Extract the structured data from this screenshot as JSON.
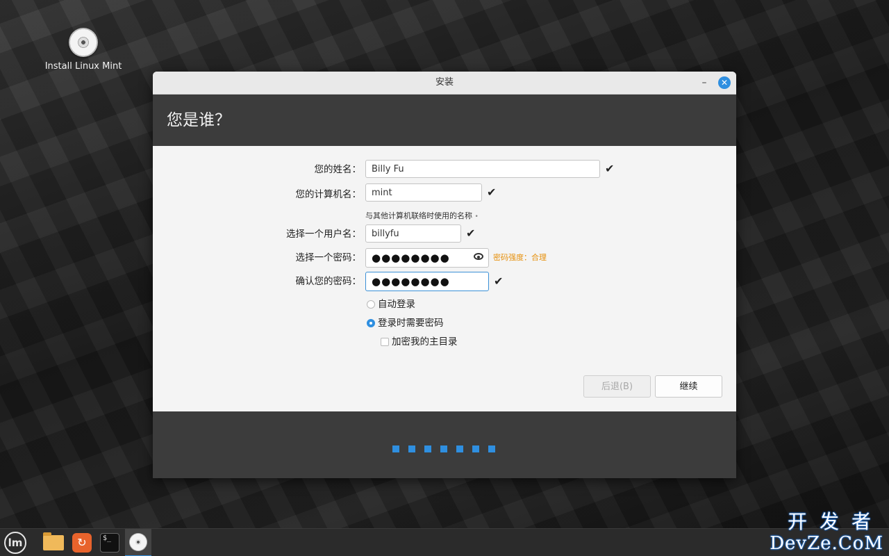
{
  "desktop": {
    "icon_label": "Install Linux Mint"
  },
  "window": {
    "title": "安装",
    "minimize_glyph": "–",
    "close_glyph": "✕",
    "heading": "您是谁？"
  },
  "form": {
    "name_label": "您的姓名：",
    "name_value": "Billy Fu",
    "computer_label": "您的计算机名：",
    "computer_value": "mint",
    "computer_hint": "与其他计算机联络时使用的名称",
    "hint_marker": "•",
    "username_label": "选择一个用户名：",
    "username_value": "billyfu",
    "password_label": "选择一个密码：",
    "password_value": "●●●●●●●●",
    "password_strength": "密码强度：合理",
    "confirm_label": "确认您的密码：",
    "confirm_value": "●●●●●●●●",
    "check_mark": "✔",
    "auto_login_label": "自动登录",
    "require_password_label": "登录时需要密码",
    "encrypt_home_label": "加密我的主目录",
    "login_mode_selected": "require_password",
    "encrypt_home_checked": false
  },
  "buttons": {
    "back_label": "后退(B)",
    "continue_label": "继续"
  },
  "progress": {
    "steps_total": 7,
    "steps_completed": 7,
    "color": "#2f8fe0"
  },
  "taskbar": {
    "menu_icon": "linux-mint-menu-icon",
    "menu_glyph": "lm",
    "files_icon": "folder-icon",
    "update_icon": "update-manager-icon",
    "update_glyph": "↻",
    "terminal_icon": "terminal-icon",
    "terminal_glyph": "$_",
    "active_app_icon": "installer-disc-icon"
  },
  "watermark": {
    "line1": "开发者",
    "line2": "DevZe.CoM"
  },
  "colors": {
    "accent": "#2f8fe0",
    "strength_warning": "#e6900c",
    "header_bg": "#3c3c3c"
  }
}
